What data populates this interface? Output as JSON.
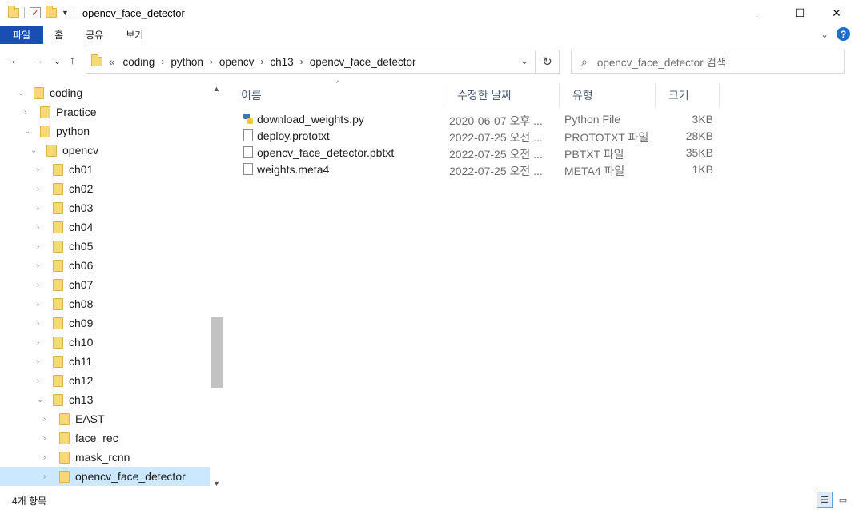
{
  "window": {
    "title": "opencv_face_detector",
    "minimize_glyph": "—",
    "maximize_glyph": "☐",
    "close_glyph": "✕"
  },
  "ribbon": {
    "tabs": [
      "파일",
      "홈",
      "공유",
      "보기"
    ],
    "help_glyph": "?"
  },
  "nav": {
    "back_glyph": "←",
    "forward_glyph": "→",
    "recent_glyph": "⌄",
    "up_glyph": "↑",
    "overflow_glyph": "«",
    "breadcrumbs": [
      "coding",
      "python",
      "opencv",
      "ch13",
      "opencv_face_detector"
    ],
    "refresh_glyph": "↻"
  },
  "search": {
    "placeholder": "opencv_face_detector 검색"
  },
  "tree": [
    {
      "label": "coding",
      "expanded": true
    },
    {
      "label": "Practice",
      "expanded": false
    },
    {
      "label": "python",
      "expanded": true
    },
    {
      "label": "opencv",
      "expanded": true
    },
    {
      "label": "ch01",
      "expanded": false
    },
    {
      "label": "ch02",
      "expanded": false
    },
    {
      "label": "ch03",
      "expanded": false
    },
    {
      "label": "ch04",
      "expanded": false
    },
    {
      "label": "ch05",
      "expanded": false
    },
    {
      "label": "ch06",
      "expanded": false
    },
    {
      "label": "ch07",
      "expanded": false
    },
    {
      "label": "ch08",
      "expanded": false
    },
    {
      "label": "ch09",
      "expanded": false
    },
    {
      "label": "ch10",
      "expanded": false
    },
    {
      "label": "ch11",
      "expanded": false
    },
    {
      "label": "ch12",
      "expanded": false
    },
    {
      "label": "ch13",
      "expanded": true
    },
    {
      "label": "EAST",
      "expanded": false
    },
    {
      "label": "face_rec",
      "expanded": false
    },
    {
      "label": "mask_rcnn",
      "expanded": false
    },
    {
      "label": "opencv_face_detector",
      "expanded": false,
      "selected": true
    }
  ],
  "columns": [
    "이름",
    "수정한 날짜",
    "유형",
    "크기"
  ],
  "files": [
    {
      "name": "download_weights.py",
      "date": "2020-06-07 오후 ...",
      "type": "Python File",
      "size": "3KB",
      "icon": "python-file-icon"
    },
    {
      "name": "deploy.prototxt",
      "date": "2022-07-25 오전 ...",
      "type": "PROTOTXT 파일",
      "size": "28KB",
      "icon": "file-icon"
    },
    {
      "name": "opencv_face_detector.pbtxt",
      "date": "2022-07-25 오전 ...",
      "type": "PBTXT 파일",
      "size": "35KB",
      "icon": "file-icon"
    },
    {
      "name": "weights.meta4",
      "date": "2022-07-25 오전 ...",
      "type": "META4 파일",
      "size": "1KB",
      "icon": "file-icon"
    }
  ],
  "status": {
    "item_count": "4개 항목"
  },
  "colors": {
    "accent": "#1a4eb3",
    "selection": "#cce8ff",
    "folder": "#f8d775"
  }
}
